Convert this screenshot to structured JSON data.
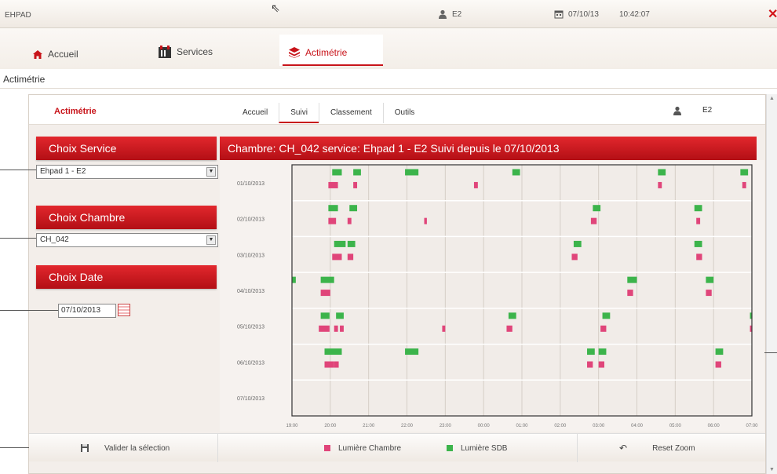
{
  "topbar": {
    "app": "EHPAD",
    "user": "E2",
    "date": "07/10/13",
    "time": "10:42:07"
  },
  "nav": {
    "home": "Accueil",
    "services": "Services",
    "actimetry": "Actimétrie"
  },
  "page_title": "Actimétrie",
  "sub": {
    "title": "Actimétrie",
    "tabs": [
      "Accueil",
      "Suivi",
      "Classement",
      "Outils"
    ],
    "user": "E2"
  },
  "left": {
    "service_title": "Choix Service",
    "service_value": "Ehpad 1 - E2",
    "room_title": "Choix Chambre",
    "room_value": "CH_042",
    "date_title": "Choix Date",
    "date_value": "07/10/2013"
  },
  "chart_title": "Chambre: CH_042 service: Ehpad 1 - E2 Suivi depuis le 07/10/2013",
  "footer": {
    "validate": "Valider la sélection",
    "reset": "Reset Zoom"
  },
  "colors": {
    "room": "#e0457a",
    "bathroom": "#3cb44b",
    "accent": "#c8141a"
  },
  "chart_data": {
    "type": "timeline",
    "dates": [
      "01/10/2013",
      "02/10/2013",
      "03/10/2013",
      "04/10/2013",
      "05/10/2013",
      "06/10/2013",
      "07/10/2013"
    ],
    "x_ticks": [
      "19:00",
      "20:00",
      "21:00",
      "22:00",
      "23:00",
      "00:00",
      "01:00",
      "02:00",
      "03:00",
      "04:00",
      "05:00",
      "06:00",
      "07:00"
    ],
    "xlim": [
      19,
      31
    ],
    "series": [
      {
        "name": "Lumière Chambre",
        "color": "#e0457a",
        "events": [
          [
            [
              19.95,
              20.2
            ],
            [
              20.6,
              20.7
            ],
            [
              23.75,
              23.85
            ],
            [
              28.55,
              28.65
            ],
            [
              30.75,
              30.85
            ]
          ],
          [
            [
              19.95,
              20.15
            ],
            [
              20.45,
              20.55
            ],
            [
              22.45,
              22.52
            ],
            [
              26.8,
              26.95
            ],
            [
              29.55,
              29.65
            ]
          ],
          [
            [
              20.05,
              20.3
            ],
            [
              20.45,
              20.6
            ],
            [
              26.3,
              26.45
            ],
            [
              29.55,
              29.7
            ]
          ],
          [
            [
              19.75,
              20.0
            ],
            [
              27.75,
              27.9
            ],
            [
              29.8,
              29.95
            ]
          ],
          [
            [
              19.7,
              19.98
            ],
            [
              20.1,
              20.2
            ],
            [
              20.25,
              20.35
            ],
            [
              22.92,
              23.0
            ],
            [
              24.6,
              24.75
            ],
            [
              27.05,
              27.2
            ],
            [
              30.95,
              31.0
            ]
          ],
          [
            [
              19.85,
              20.1
            ],
            [
              20.1,
              20.22
            ],
            [
              26.7,
              26.85
            ],
            [
              27.0,
              27.15
            ],
            [
              30.05,
              30.2
            ]
          ],
          []
        ]
      },
      {
        "name": "Lumière SDB",
        "color": "#3cb44b",
        "events": [
          [
            [
              20.05,
              20.3
            ],
            [
              20.6,
              20.8
            ],
            [
              21.95,
              22.3
            ],
            [
              24.75,
              24.95
            ],
            [
              28.55,
              28.75
            ],
            [
              30.7,
              30.9
            ]
          ],
          [
            [
              19.95,
              20.2
            ],
            [
              20.5,
              20.7
            ],
            [
              26.85,
              27.05
            ],
            [
              29.5,
              29.7
            ]
          ],
          [
            [
              20.1,
              20.4
            ],
            [
              20.45,
              20.65
            ],
            [
              26.35,
              26.55
            ],
            [
              29.5,
              29.7
            ]
          ],
          [
            [
              19.0,
              19.1
            ],
            [
              19.75,
              20.1
            ],
            [
              27.75,
              28.0
            ],
            [
              29.8,
              30.0
            ]
          ],
          [
            [
              19.75,
              19.98
            ],
            [
              20.15,
              20.35
            ],
            [
              24.65,
              24.85
            ],
            [
              27.1,
              27.3
            ],
            [
              30.95,
              31.0
            ]
          ],
          [
            [
              19.85,
              20.3
            ],
            [
              21.95,
              22.3
            ],
            [
              26.7,
              26.9
            ],
            [
              27.0,
              27.2
            ],
            [
              30.05,
              30.25
            ]
          ],
          []
        ]
      }
    ]
  }
}
